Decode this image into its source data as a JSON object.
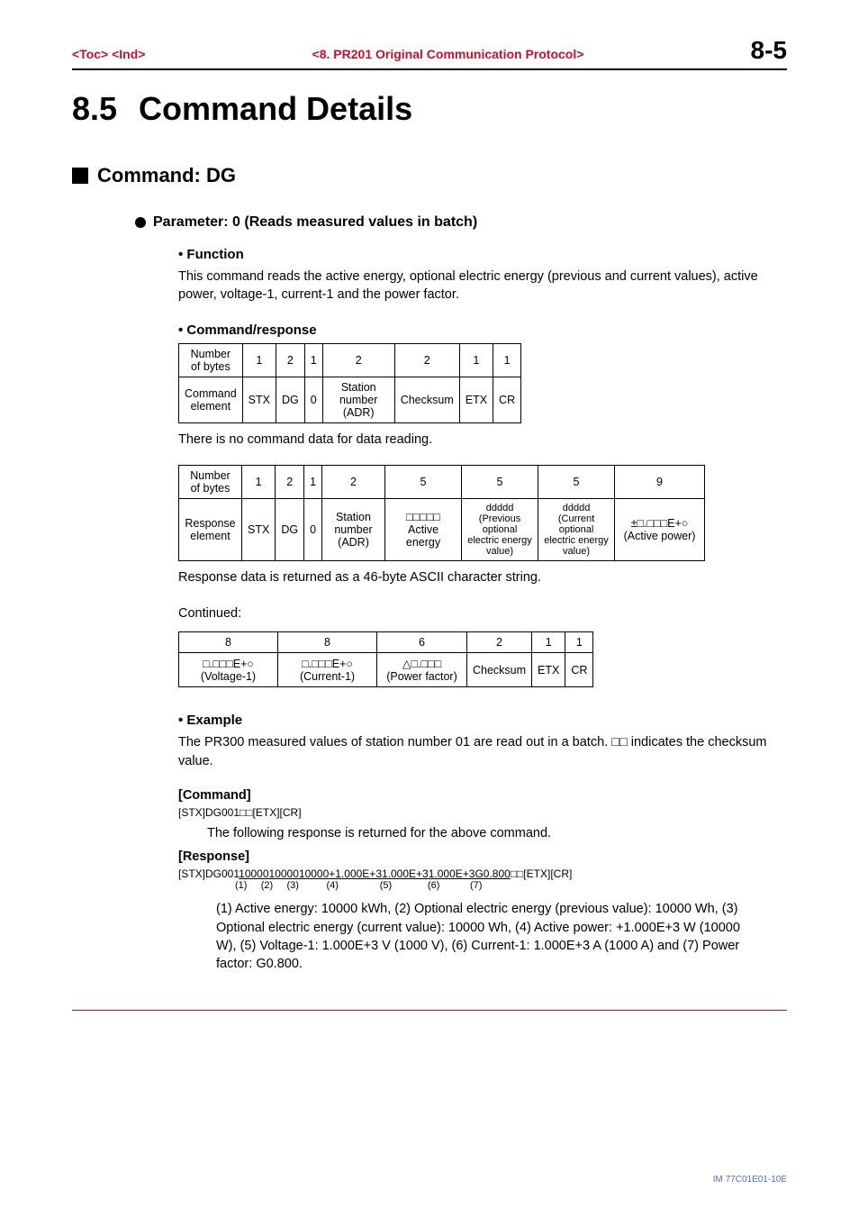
{
  "header": {
    "toc": "<Toc>",
    "ind": "<Ind>",
    "chapter": "<8.  PR201 Original Communication Protocol>",
    "page": "8-5"
  },
  "section": {
    "num": "8.5",
    "title": "Command Details"
  },
  "h2": "Command: DG",
  "h3": "Parameter: 0 (Reads measured values in batch)",
  "func": {
    "h": "•  Function",
    "t": "This command reads the active energy, optional electric energy (previous and current values), active power, voltage-1, current-1 and the power factor."
  },
  "cmd": {
    "h": "•  Command/response",
    "t1": {
      "r1": [
        "Number of bytes",
        "1",
        "2",
        "1",
        "2",
        "2",
        "1",
        "1"
      ],
      "r2": [
        "Command element",
        "STX",
        "DG",
        "0",
        "Station number (ADR)",
        "Checksum",
        "ETX",
        "CR"
      ]
    },
    "note1": "There is no command data for data reading.",
    "t2": {
      "r1": [
        "Number of bytes",
        "1",
        "2",
        "1",
        "2",
        "5",
        "5",
        "5",
        "9"
      ],
      "r2": [
        "Response element",
        "STX",
        "DG",
        "0",
        "Station number (ADR)",
        "□□□□□\nActive energy",
        "ddddd\n(Previous optional electric energy value)",
        "ddddd\n(Current optional electric energy value)",
        "±□.□□□E+○\n(Active power)"
      ]
    },
    "note2": "Response data is returned as a 46-byte ASCII character string.",
    "cont": "Continued:",
    "t3": {
      "r1": [
        "8",
        "8",
        "6",
        "2",
        "1",
        "1"
      ],
      "r2": [
        "□.□□□E+○\n(Voltage-1)",
        "□.□□□E+○\n(Current-1)",
        "△□.□□□\n(Power factor)",
        "Checksum",
        "ETX",
        "CR"
      ]
    }
  },
  "ex": {
    "h": "•  Example",
    "intro": "The PR300 measured values of station number 01 are read out in a batch. □□ indicates the checksum value.",
    "cmdlabel": "[Command]",
    "cmdline": "[STX]DG001□□[ETX][CR]",
    "follow": "The following response is returned for the above command.",
    "resplabel": "[Response]",
    "resp_pre": "[STX]DG001",
    "resp_u1": "10000",
    "resp_u2": "10000",
    "resp_u3": "10000",
    "resp_u4": "+1.000E+3",
    "resp_u5": "1.000E+3",
    "resp_u6": "1.000E+3",
    "resp_u7": "G0.800",
    "resp_post": "□□[ETX][CR]",
    "resp_ref": "(1)     (2)     (3)          (4)               (5)             (6)           (7)",
    "explain": "(1) Active energy: 10000 kWh, (2) Optional electric energy (previous value): 10000 Wh, (3) Optional electric energy (current value): 10000 Wh, (4) Active power: +1.000E+3 W (10000 W), (5) Voltage-1: 1.000E+3 V (1000 V), (6) Current-1: 1.000E+3 A (1000 A) and (7) Power factor: G0.800."
  },
  "footer": "IM 77C01E01-10E"
}
